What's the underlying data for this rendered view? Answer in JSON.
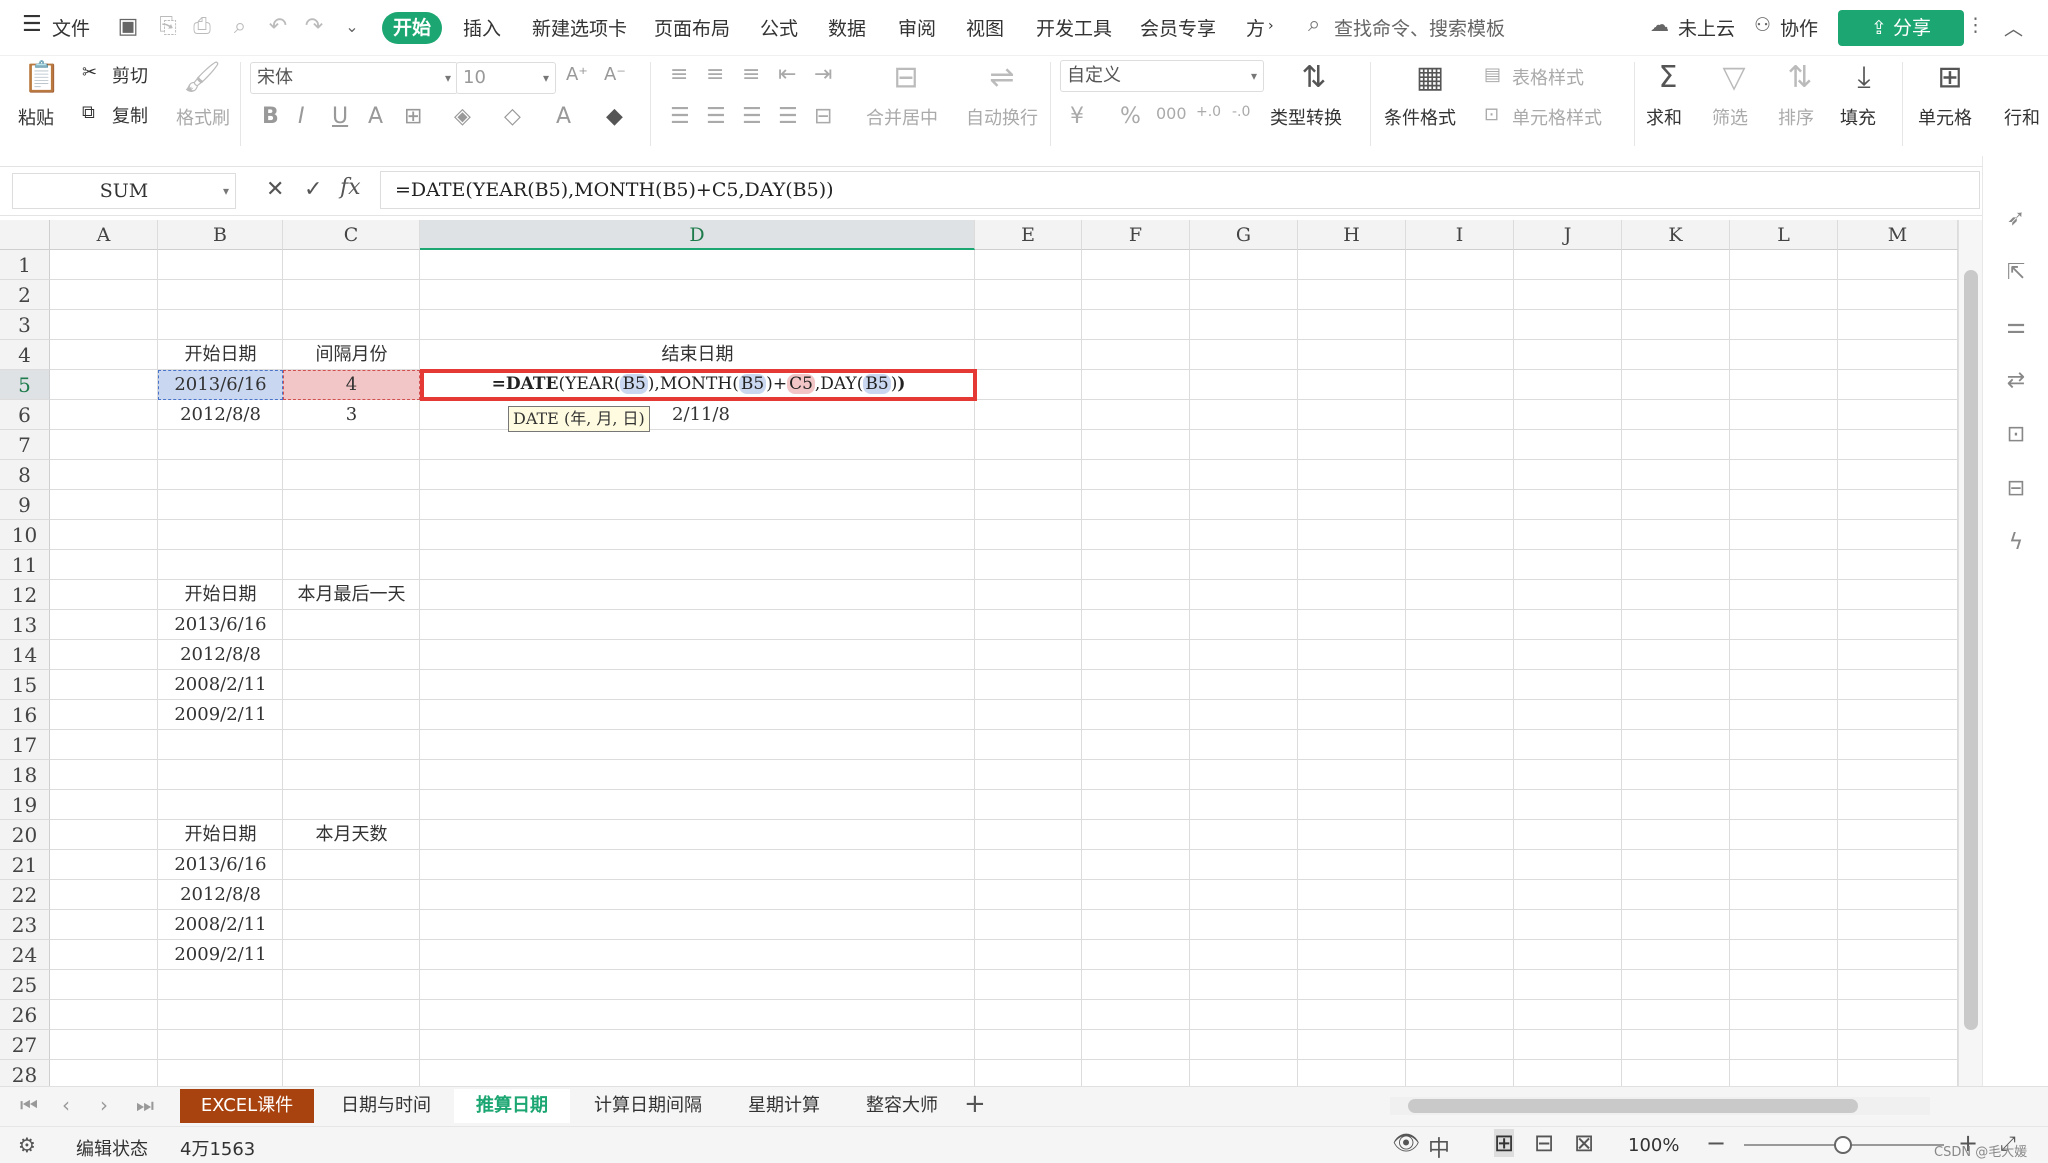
{
  "menubar": {
    "file": "文件",
    "tabs": [
      "开始",
      "插入",
      "新建选项卡",
      "页面布局",
      "公式",
      "数据",
      "审阅",
      "视图",
      "开发工具",
      "会员专享",
      "方"
    ],
    "search_placeholder": "查找命令、搜索模板",
    "cloud": "未上云",
    "collab": "协作",
    "share": "分享"
  },
  "ribbon": {
    "paste": "粘贴",
    "cut": "剪切",
    "copy": "复制",
    "format_painter": "格式刷",
    "font_name": "宋体",
    "font_size": "10",
    "merge_center": "合并居中",
    "wrap_text": "自动换行",
    "number_format": "自定义",
    "type_convert": "类型转换",
    "cond_format": "条件格式",
    "table_style": "表格样式",
    "cell_style": "单元格样式",
    "sum": "求和",
    "filter": "筛选",
    "sort": "排序",
    "fill": "填充",
    "cells": "单元格",
    "rows_cols": "行和"
  },
  "formula_bar": {
    "name_box": "SUM",
    "formula": "=DATE(YEAR(B5),MONTH(B5)+C5,DAY(B5))"
  },
  "columns": [
    "A",
    "B",
    "C",
    "D",
    "E",
    "F",
    "G",
    "H",
    "I",
    "J",
    "K",
    "L",
    "M"
  ],
  "rows": [
    "1",
    "2",
    "3",
    "4",
    "5",
    "6",
    "7",
    "8",
    "9",
    "10",
    "11",
    "12",
    "13",
    "14",
    "15",
    "16",
    "17",
    "18",
    "19",
    "20",
    "21",
    "22",
    "23",
    "24",
    "25",
    "26",
    "27",
    "28"
  ],
  "cells": {
    "b4": "开始日期",
    "c4": "间隔月份",
    "d4": "结束日期",
    "b5": "2013/6/16",
    "c5": "4",
    "b6": "2012/8/8",
    "c6": "3",
    "d6_partial": "2/11/8",
    "b12": "开始日期",
    "c12": "本月最后一天",
    "b13": "2013/6/16",
    "b14": "2012/8/8",
    "b15": "2008/2/11",
    "b16": "2009/2/11",
    "b20": "开始日期",
    "c20": "本月天数",
    "b21": "2013/6/16",
    "b22": "2012/8/8",
    "b23": "2008/2/11",
    "b24": "2009/2/11"
  },
  "editing": {
    "prefix": "=",
    "fn": "DATE",
    "year": "YEAR",
    "month": "MONTH",
    "day": "DAY",
    "ref_b5": "B5",
    "ref_c5": "C5",
    "plus": "+",
    "comma": ",",
    "lparen": "(",
    "rparen": ")",
    "tooltip": "DATE (年, 月, 日)"
  },
  "sheets": [
    "EXCEL课件",
    "日期与时间",
    "推算日期",
    "计算日期间隔",
    "星期计算",
    "整容大师"
  ],
  "status": {
    "mode": "编辑状态",
    "count": "4万1563",
    "zoom": "100%",
    "watermark": "CSDN @毛大媛"
  },
  "colors": {
    "accent": "#1ca672",
    "highlight_box": "#e53935",
    "ref_blue": "#c9d7f0",
    "ref_red": "#f2c6c6"
  }
}
